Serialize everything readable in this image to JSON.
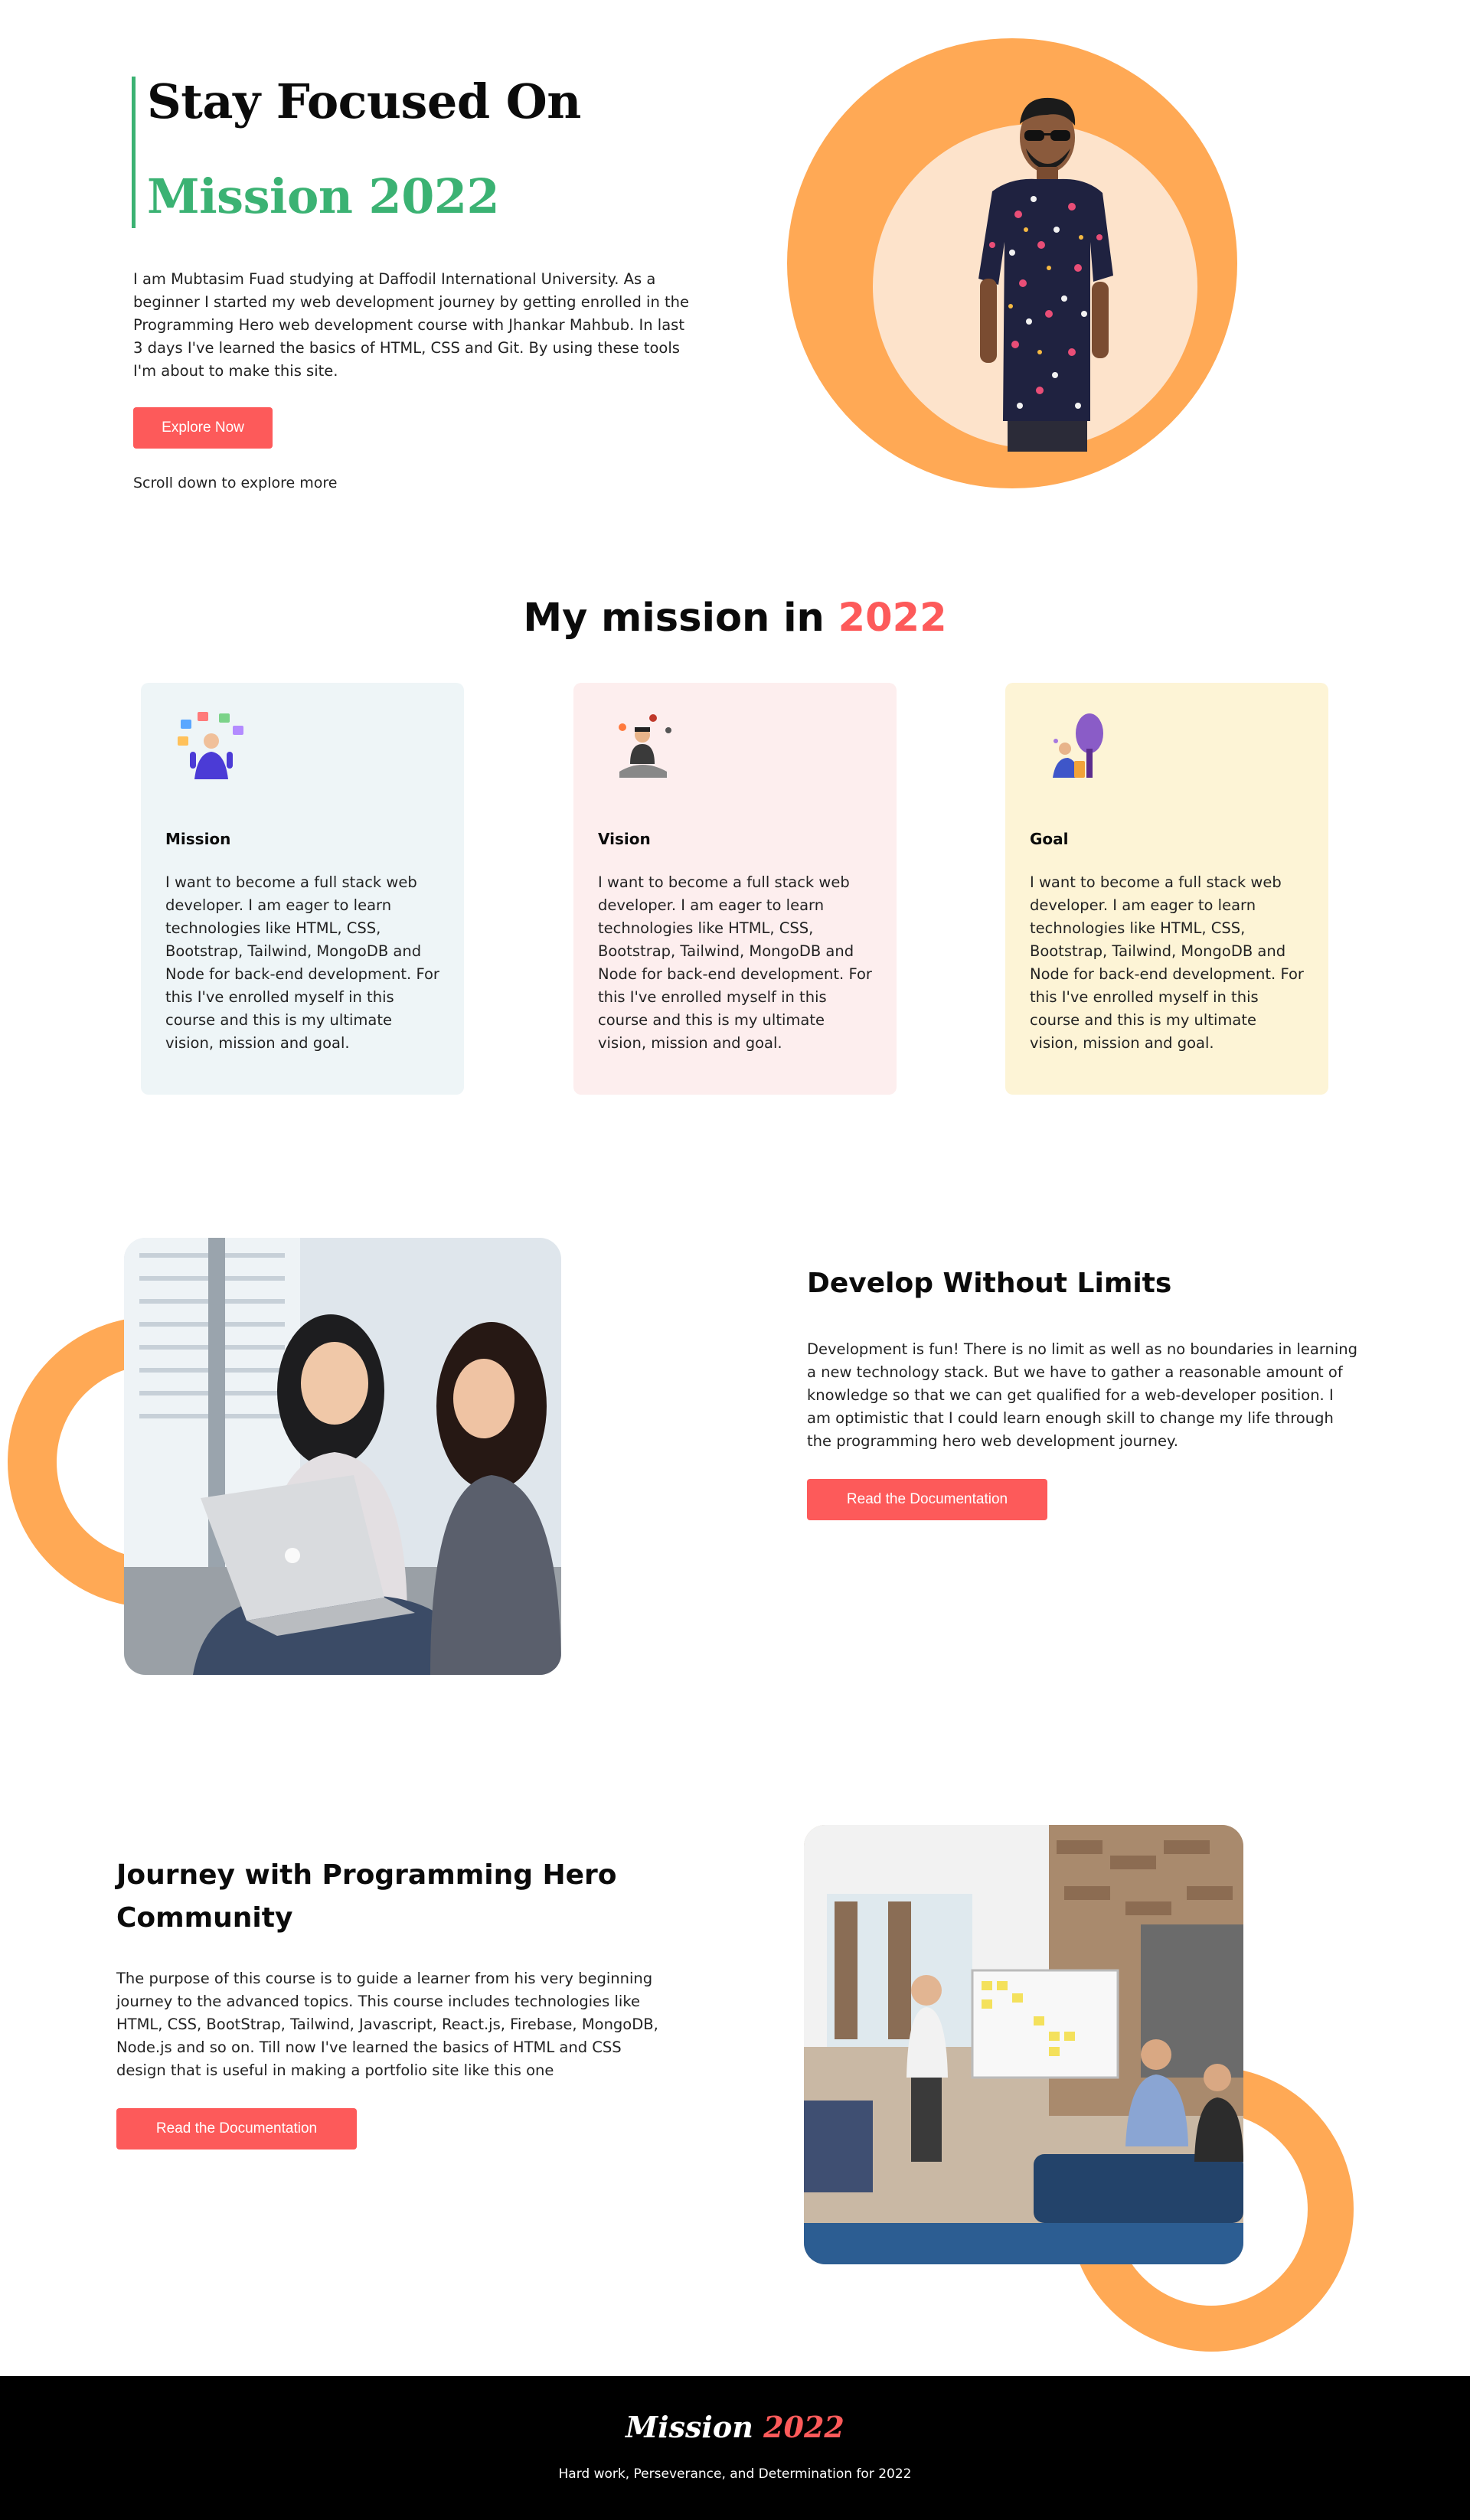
{
  "hero": {
    "title_line1": "Stay Focused On",
    "title_line2": "Mission 2022",
    "description": "I am Mubtasim Fuad studying at Daffodil International University. As a beginner I started my web development journey by getting enrolled in the Programming Hero web development course with Jhankar Mahbub. In last 3 days I've learned the basics of HTML, CSS and Git. By using these tools I'm about to make this site.",
    "button_label": "Explore Now",
    "scroll_hint": "Scroll down to explore more"
  },
  "mission": {
    "heading_prefix": "My mission in ",
    "heading_accent": "2022",
    "cards": [
      {
        "title": "Mission",
        "icon": "juggling-person-icon",
        "text": "I want to become a full stack web developer. I am eager to learn technologies like HTML, CSS, Bootstrap, Tailwind, MongoDB and Node for back-end development. For this I've enrolled myself in this course and this is my ultimate vision, mission and goal."
      },
      {
        "title": "Vision",
        "icon": "meditating-person-icon",
        "text": "I want to become a full stack web developer. I am eager to learn technologies like HTML, CSS, Bootstrap, Tailwind, MongoDB and Node for back-end development. For this I've enrolled myself in this course and this is my ultimate vision, mission and goal."
      },
      {
        "title": "Goal",
        "icon": "person-under-tree-icon",
        "text": "I want to become a full stack web developer. I am eager to learn technologies like HTML, CSS, Bootstrap, Tailwind, MongoDB and Node for back-end development. For this I've enrolled myself in this course and this is my ultimate vision, mission and goal."
      }
    ]
  },
  "develop": {
    "title": "Develop Without Limits",
    "description": "Development is fun! There is no limit as well as no boundaries in learning a new technology stack. But we have to gather a reasonable amount of knowledge so that we can get qualified for a web-developer position. I am optimistic that I could learn enough skill to change my life through the programming hero web development journey.",
    "button_label": "Read the Documentation"
  },
  "journey": {
    "title": "Journey with Programming Hero Community",
    "description": "The purpose of this course is to guide a learner from his very beginning journey to the advanced topics. This course includes technologies like HTML, CSS, BootStrap, Tailwind, Javascript, React.js, Firebase, MongoDB, Node.js and so on. Till now I've learned the basics of HTML and CSS design that is useful in making a portfolio site like this one",
    "button_label": "Read the Documentation"
  },
  "footer": {
    "logo_prefix": "Mission ",
    "logo_accent": "2022",
    "tagline": "Hard work, Perseverance, and Determination for 2022"
  },
  "colors": {
    "accent_red": "#fd5a5a",
    "accent_green": "#3bb273",
    "ring_orange": "#ffa955",
    "ring_inner": "#fde3cb",
    "mission_card_bg": "#eef5f7",
    "vision_card_bg": "#fdeeee",
    "goal_card_bg": "#fdf4d6",
    "footer_bg": "#000000"
  }
}
